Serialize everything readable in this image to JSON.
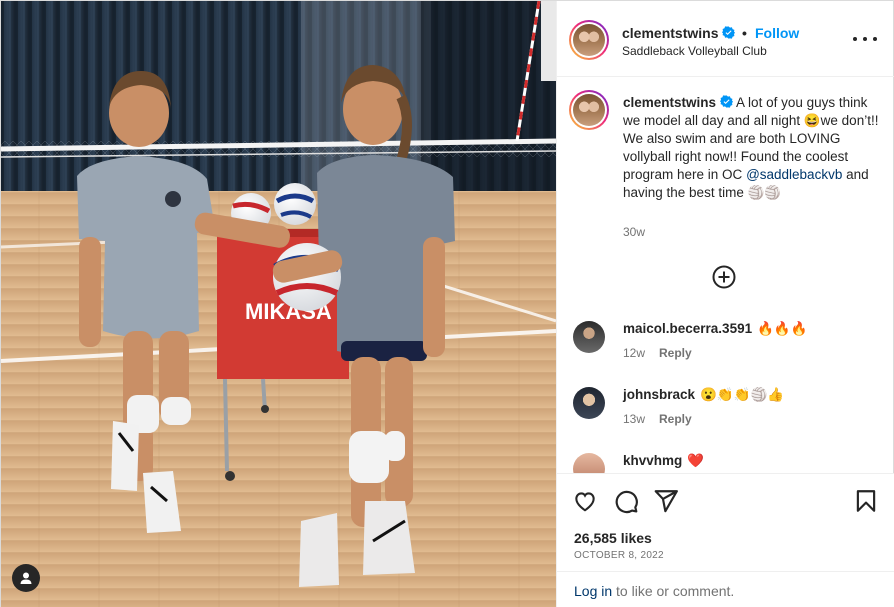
{
  "post": {
    "username": "clementstwins",
    "follow_label": "Follow",
    "separator": "•",
    "location": "Saddleback Volleyball Club",
    "caption": {
      "username": "clementstwins",
      "text_part1": "A lot of you guys think we model all day and all night 😆we don’t!! We also swim and are both LOVING vollyball right now!! Found the coolest program here in OC ",
      "mention": "@saddlebackvb",
      "text_part2": " and having the best time 🏐🏐",
      "time": "30w"
    },
    "photo_sign_text": "MIKASA"
  },
  "comments": [
    {
      "username": "maicol.becerra.3591",
      "text": "🔥🔥🔥",
      "time": "12w",
      "reply_label": "Reply"
    },
    {
      "username": "johnsbrack",
      "text": "😮👏👏🏐👍",
      "time": "13w",
      "reply_label": "Reply"
    },
    {
      "username": "khvvhmg",
      "text": "❤️",
      "time": "",
      "reply_label": ""
    }
  ],
  "engagement": {
    "likes": "26,585 likes",
    "date": "OCTOBER 8, 2022"
  },
  "login": {
    "link_label": "Log in",
    "rest": " to like or comment."
  },
  "icons": {
    "verified": "verified-badge-icon",
    "more": "more-options-icon",
    "load_more": "plus-circle-icon",
    "like": "heart-icon",
    "comment": "comment-icon",
    "share": "paper-plane-icon",
    "save": "bookmark-icon",
    "tag": "user-tag-icon"
  },
  "colors": {
    "accent_blue": "#0095f6",
    "link_dark_blue": "#00376b",
    "text_primary": "#262626",
    "text_secondary": "#737373",
    "border": "#dbdbdb"
  }
}
